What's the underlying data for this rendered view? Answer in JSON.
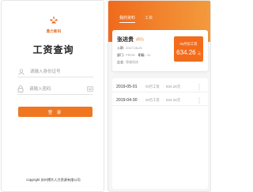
{
  "login": {
    "logo_text": "鼎力新科",
    "title": "工资查询",
    "id_placeholder": "请输入身份证号",
    "password_placeholder": "请输入密码",
    "submit_label": "登 录",
    "copyright": "copyright  苏州博大人力资源有限公司",
    "accent_color": "#f07622"
  },
  "salary_app": {
    "tabs": [
      {
        "label": "我的资料",
        "active": true
      },
      {
        "label": "工资",
        "active": false
      }
    ],
    "profile": {
      "name": "张进贵",
      "role_tag": "(职员)",
      "hire_date_label": "入职:",
      "hire_date": "2017-08-25",
      "department_label": "部门:",
      "department": "PROD",
      "position_label": "职级:",
      "position": "1C",
      "company_label": "企业:",
      "company": "恩普科技"
    },
    "badge": {
      "label": "03月份工资",
      "amount": "634.26",
      "unit": "元"
    },
    "records": [
      {
        "date": "2019-05-01",
        "type": "03月工资",
        "amount": "634.26元"
      },
      {
        "date": "2019-04-30",
        "type": "02月工资",
        "amount": "634.26元"
      }
    ],
    "header_gradient": [
      "#f06a1c",
      "#f39b3c"
    ]
  }
}
